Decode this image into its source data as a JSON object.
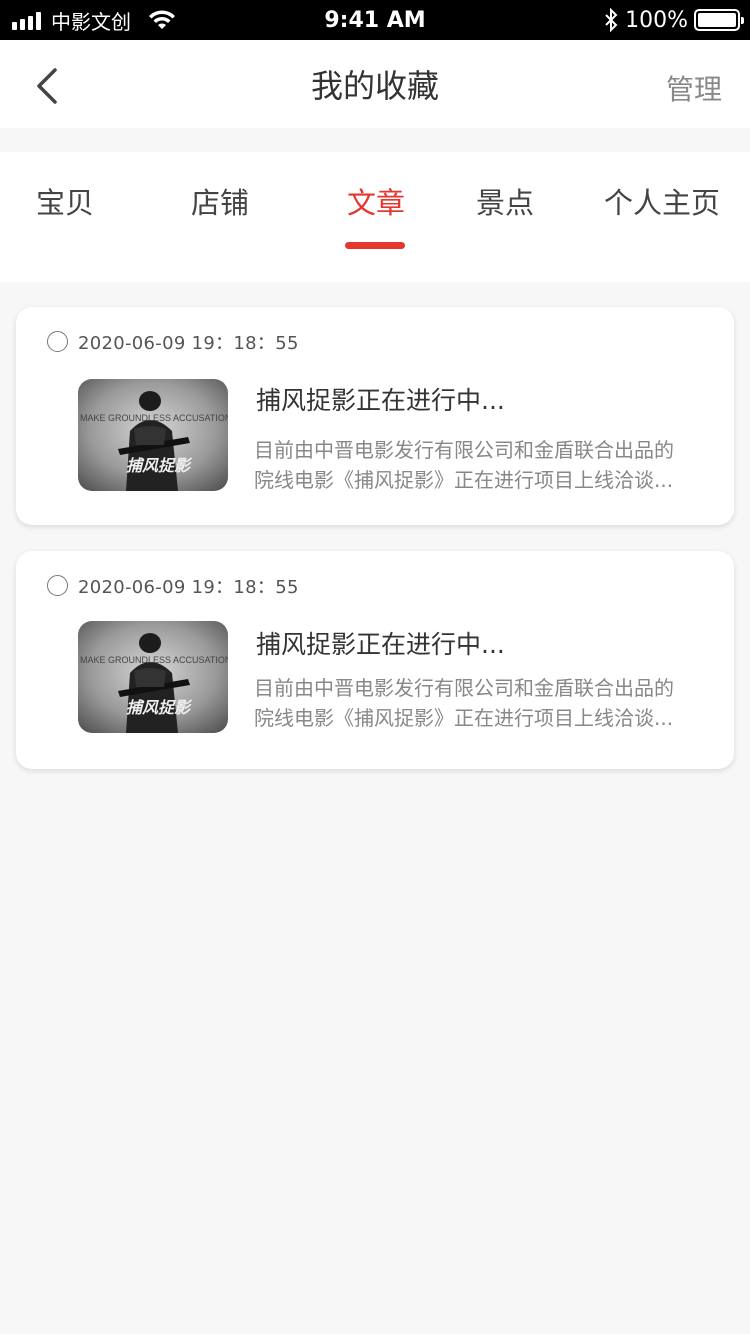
{
  "status_bar": {
    "carrier": "中影文创",
    "time": "9:41 AM",
    "battery": "100%",
    "battery_level": 1.0
  },
  "nav": {
    "title": "我的收藏",
    "manage_label": "管理",
    "back_icon": "chevron-left-icon"
  },
  "tabs": [
    {
      "label": "宝贝",
      "active": false
    },
    {
      "label": "店铺",
      "active": false
    },
    {
      "label": "文章",
      "active": true
    },
    {
      "label": "景点",
      "active": false
    },
    {
      "label": "个人主页",
      "active": false
    }
  ],
  "colors": {
    "accent": "#e5362f",
    "text_primary": "#333333",
    "text_secondary": "#888888",
    "background": "#f7f7f7"
  },
  "articles": [
    {
      "date": "2020-06-09 19：18：55",
      "title": "捕风捉影正在进行中...",
      "desc_line1": "目前由中晋电影发行有限公司和金盾联合出品的",
      "desc_line2": "院线电影《捕风捉影》正在进行项目上线洽谈...",
      "thumb_text_top": "MAKE GROUNDLESS ACCUSATIONS",
      "thumb_text_main": "捕风捉影",
      "selected": false
    },
    {
      "date": "2020-06-09 19：18：55",
      "title": "捕风捉影正在进行中...",
      "desc_line1": "目前由中晋电影发行有限公司和金盾联合出品的",
      "desc_line2": "院线电影《捕风捉影》正在进行项目上线洽谈...",
      "thumb_text_top": "MAKE GROUNDLESS ACCUSATIONS",
      "thumb_text_main": "捕风捉影",
      "selected": false
    }
  ]
}
